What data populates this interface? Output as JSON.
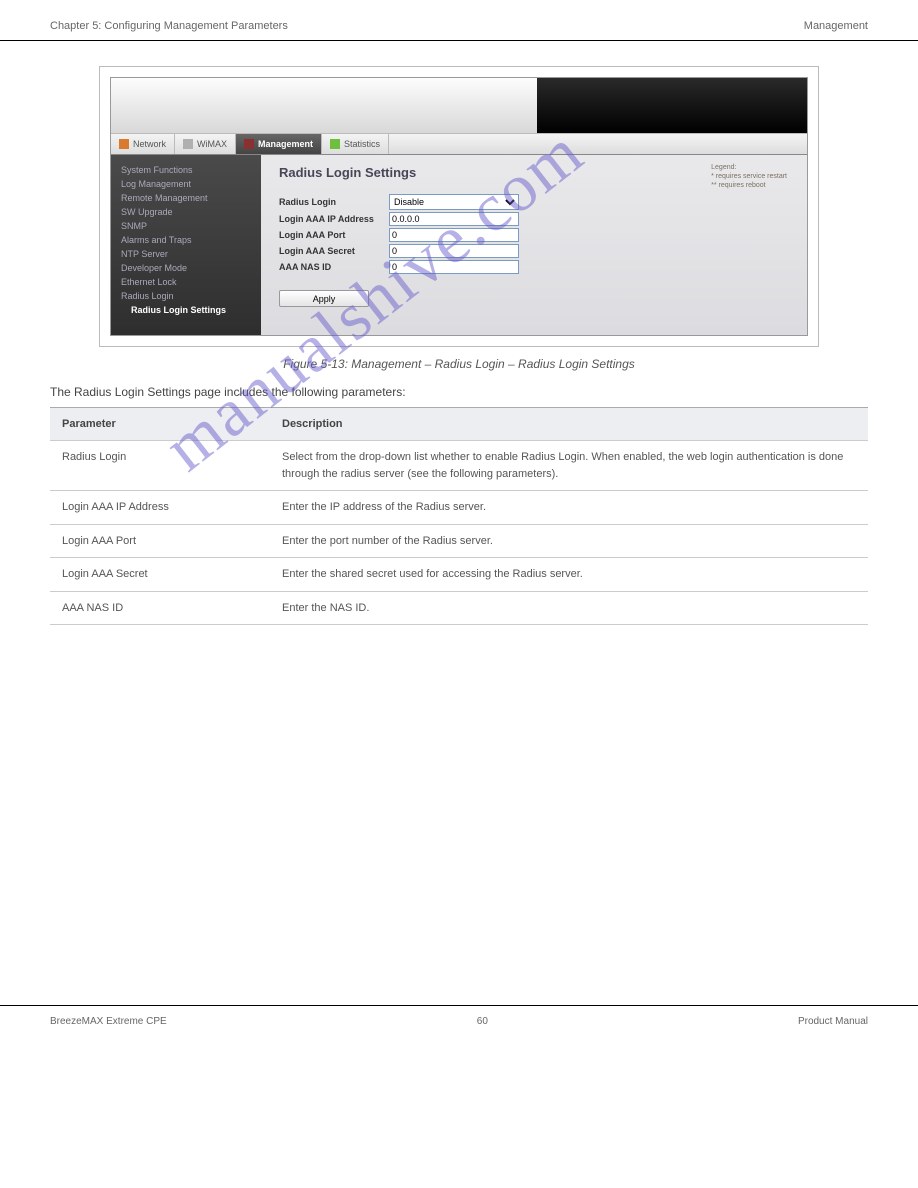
{
  "header": {
    "left": "Chapter 5: Configuring Management Parameters",
    "right": "Management"
  },
  "tabs": [
    "Network",
    "WiMAX",
    "Management",
    "Statistics"
  ],
  "tabs_active": 2,
  "sidebar": [
    "System Functions",
    "Log Management",
    "Remote Management",
    "SW Upgrade",
    "SNMP",
    "Alarms and Traps",
    "NTP Server",
    "Developer Mode",
    "Ethernet Lock",
    "Radius Login",
    "Radius Login Settings"
  ],
  "sidebar_active": 10,
  "panel": {
    "title": "Radius Login Settings",
    "legend": {
      "title": "Legend:",
      "line1": "* requires service restart",
      "line2": "** requires reboot"
    },
    "rows": [
      {
        "label": "Radius Login",
        "type": "select",
        "value": "Disable"
      },
      {
        "label": "Login AAA IP Address",
        "type": "text",
        "value": "0.0.0.0"
      },
      {
        "label": "Login AAA Port",
        "type": "text",
        "value": "0"
      },
      {
        "label": "Login AAA Secret",
        "type": "text",
        "value": "0"
      },
      {
        "label": "AAA NAS ID",
        "type": "text",
        "value": "0"
      }
    ],
    "apply": "Apply"
  },
  "figure_caption": "Figure 5-13: Management – Radius Login – Radius Login Settings",
  "table_intro": "The Radius Login Settings page includes the following parameters:",
  "table": {
    "headers": [
      "Parameter",
      "Description"
    ],
    "rows": [
      [
        "Radius Login",
        "Select from the drop-down list whether to enable Radius Login. When enabled, the web login authentication is done through the radius server (see the following parameters)."
      ],
      [
        "Login AAA IP Address",
        "Enter the IP address of the Radius server."
      ],
      [
        "Login AAA Port",
        "Enter the port number of the Radius server."
      ],
      [
        "Login AAA Secret",
        "Enter the shared secret used for accessing the Radius server."
      ],
      [
        "AAA NAS ID",
        "Enter the NAS ID."
      ]
    ]
  },
  "footer": {
    "left": "BreezeMAX Extreme CPE",
    "center": "60",
    "right": "Product Manual"
  },
  "watermark": "manualshive.com"
}
